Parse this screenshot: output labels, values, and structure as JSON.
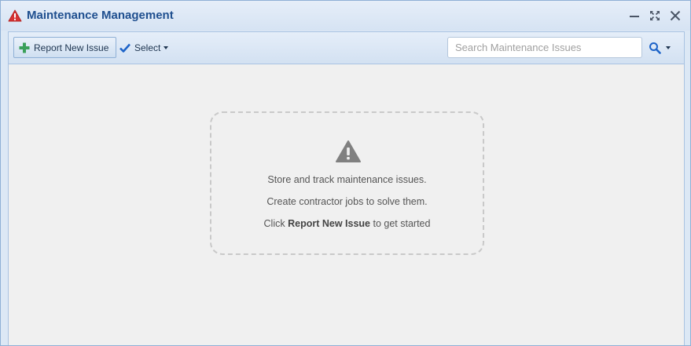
{
  "window": {
    "title": "Maintenance Management",
    "icon": "warning-triangle-icon",
    "controls": [
      "minimize-icon",
      "maximize-icon",
      "close-icon"
    ]
  },
  "toolbar": {
    "report_new_issue_label": "Report New Issue",
    "report_new_issue_icon": "plus-icon",
    "select_label": "Select",
    "select_icon": "checkmark-icon",
    "search": {
      "value": "",
      "placeholder": "Search Maintenance Issues",
      "icon": "search-icon"
    }
  },
  "empty_state": {
    "icon": "warning-triangle-icon",
    "line1": "Store and track maintenance issues.",
    "line2": "Create contractor jobs to solve them.",
    "line3_prefix": "Click",
    "line3_bold": "Report New Issue",
    "line3_suffix": "to get started"
  },
  "colors": {
    "title_text": "#1f4f8f",
    "warning_red": "#d63333",
    "plus_green": "#3aa05a",
    "check_blue": "#1d63c8",
    "content_bg": "#f0f0f0"
  }
}
